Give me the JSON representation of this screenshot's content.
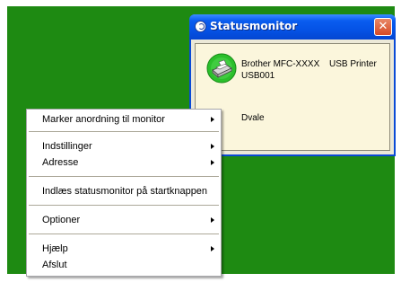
{
  "status_monitor": {
    "title": "Statusmonitor",
    "close_symbol": "✕",
    "title_icon": "status-monitor-icon",
    "device_name": "Brother MFC-XXXX",
    "connection": "USB Printer",
    "port": "USB001",
    "status": "Dvale",
    "printer_icon": "printer-icon",
    "status_color": "#2bbf2b"
  },
  "menu": {
    "items": [
      {
        "label": "Marker anordning til monitor",
        "submenu": true
      },
      {
        "label": "Indstillinger",
        "submenu": true
      },
      {
        "label": "Adresse",
        "submenu": true
      },
      {
        "label": "Indlæs statusmonitor på startknappen",
        "submenu": false
      },
      {
        "label": "Optioner",
        "submenu": true
      },
      {
        "label": "Hjælp",
        "submenu": true
      },
      {
        "label": "Afslut",
        "submenu": false
      }
    ]
  },
  "colors": {
    "desktop": "#1e8a12",
    "titlebar": "#0553e6",
    "close_button": "#d74a25"
  }
}
